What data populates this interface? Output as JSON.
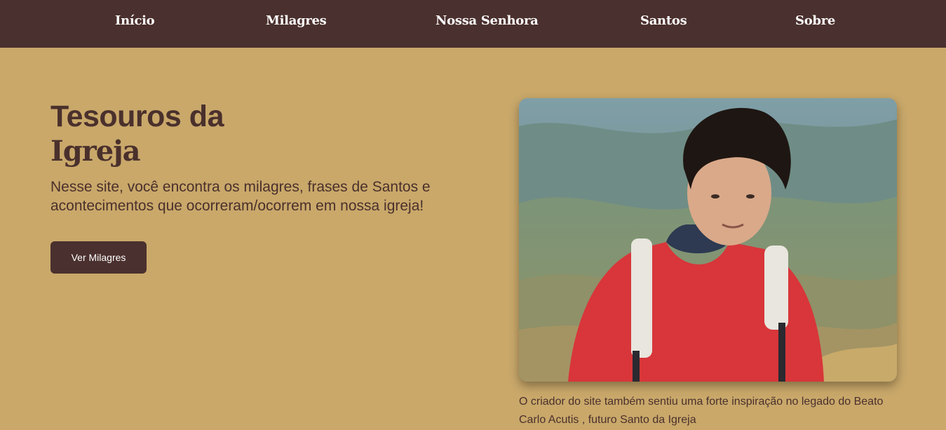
{
  "nav": {
    "items": [
      {
        "label": "Início"
      },
      {
        "label": "Milagres"
      },
      {
        "label": "Nossa Senhora"
      },
      {
        "label": "Santos"
      },
      {
        "label": "Sobre"
      }
    ]
  },
  "hero": {
    "title_line1": "Tesouros da",
    "title_line2": "Igreja",
    "subtitle": "Nesse site, você encontra os milagres, frases de Santos e acontecimentos que ocorreram/ocorrem em nossa igreja!",
    "button_label": "Ver Milagres"
  },
  "feature": {
    "caption": "O criador do site também sentiu uma forte inspiração no legado do Beato Carlo Acutis , futuro Santo da Igreja"
  },
  "colors": {
    "nav_bg": "#4a302e",
    "page_bg": "#c9a86a",
    "text": "#4a302c",
    "button_bg": "#4a302e"
  }
}
